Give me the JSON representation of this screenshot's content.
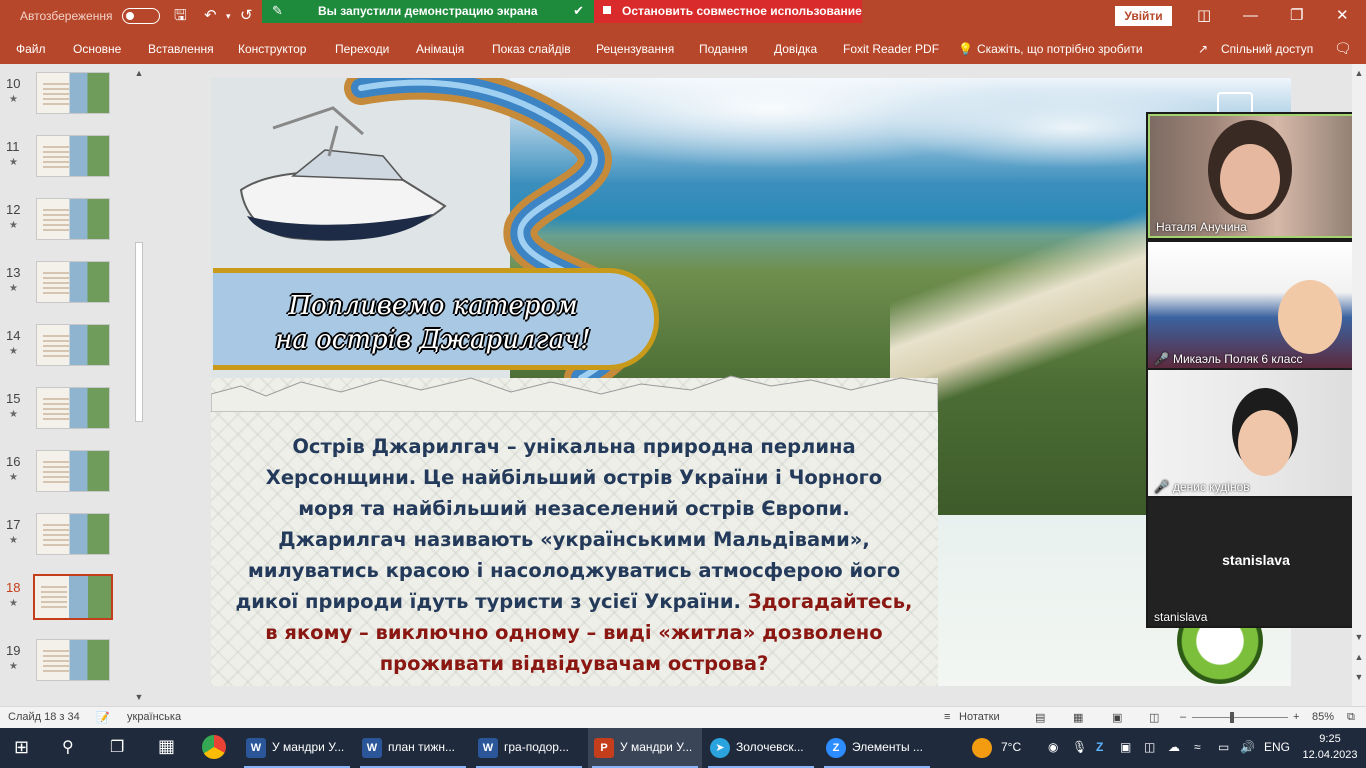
{
  "titlebar": {
    "autosave_label": "Автозбереження",
    "share_active_label": "Вы запустили демонстрацию экрана",
    "share_stop_label": "Остановить совместное использование",
    "signin_label": "Увійти"
  },
  "menu": {
    "items": [
      "Файл",
      "Основне",
      "Вставлення",
      "Конструктор",
      "Переходи",
      "Анімація",
      "Показ слайдів",
      "Рецензування",
      "Подання",
      "Довідка",
      "Foxit Reader PDF"
    ],
    "tell_me": "Скажіть, що потрібно зробити",
    "share": "Спільний доступ"
  },
  "thumbnails": [
    {
      "num": "10",
      "star": "★"
    },
    {
      "num": "11",
      "star": "★"
    },
    {
      "num": "12",
      "star": "★"
    },
    {
      "num": "13",
      "star": "★"
    },
    {
      "num": "14",
      "star": "★"
    },
    {
      "num": "15",
      "star": "★"
    },
    {
      "num": "16",
      "star": "★"
    },
    {
      "num": "17",
      "star": "★"
    },
    {
      "num": "18",
      "star": "★"
    },
    {
      "num": "19",
      "star": "★"
    }
  ],
  "slide": {
    "banner_line1": "Попливемо катером",
    "banner_line2": "на острів Джарилгач!",
    "body": "Острів Джарилгач – унікальна природна перлина Херсонщини. Це найбільший острів України і Чорного моря та найбільший незаселений острів Європи. Джарилгач називають «українськими Мальдівами», милуватись красою і насолоджуватись атмосферою його дикої природи їдуть туристи з усієї України.",
    "question": "Здогадайтесь, в якому – виключно одному – виді «житла» дозволено проживати відвідувачам острова?"
  },
  "video": {
    "p1": "Наталя Анучина",
    "p2": "Микаэль Поляк 6 класс",
    "p3": "денис кудінов",
    "p4_center": "stanislava",
    "p4_label": "stanislava"
  },
  "status": {
    "slide_info": "Слайд 18 з 34",
    "language": "українська",
    "notes": "Нотатки",
    "zoom": "85%"
  },
  "taskbar": {
    "apps": [
      {
        "label": "У мандри У...",
        "icon": "W",
        "color": "#2b579a"
      },
      {
        "label": "план тижн...",
        "icon": "W",
        "color": "#2b579a"
      },
      {
        "label": "гра-подор...",
        "icon": "W",
        "color": "#2b579a"
      },
      {
        "label": "У мандри У...",
        "icon": "P",
        "color": "#c43e1c"
      },
      {
        "label": "Золочевск...",
        "icon": "➤",
        "color": "#2aa3df"
      },
      {
        "label": "Элементы ...",
        "icon": "Z",
        "color": "#2d8cff"
      }
    ],
    "weather": "7°C",
    "lang": "ENG",
    "time": "9:25",
    "date": "12.04.2023"
  },
  "colors": {
    "accent": "#b7472a",
    "share_green": "#1e8a3c",
    "share_red": "#d92b2b",
    "banner_fill": "#a9c8e3",
    "banner_border": "#c99a1a",
    "body_text": "#243a5a",
    "question_text": "#8a1712"
  }
}
